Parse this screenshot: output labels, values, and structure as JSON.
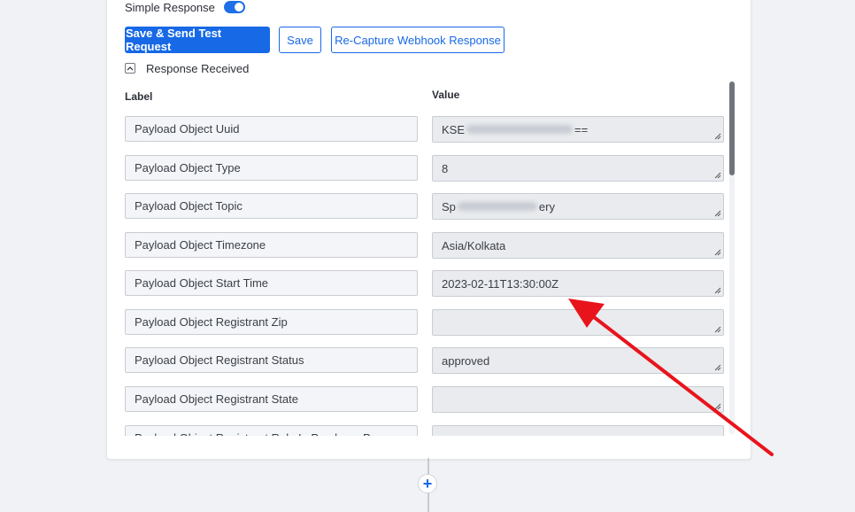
{
  "simple_response": {
    "label": "Simple Response",
    "enabled": true
  },
  "buttons": {
    "save_send": "Save & Send Test Request",
    "save": "Save",
    "recapture": "Re-Capture Webhook Response"
  },
  "response_received": {
    "label": "Response Received",
    "expanded": true
  },
  "table": {
    "label_header": "Label",
    "value_header": "Value",
    "rows": [
      {
        "label": "Payload Object Uuid",
        "value_prefix": "KSE",
        "value_suffix": "==",
        "blurred": true
      },
      {
        "label": "Payload Object Type",
        "value": "8"
      },
      {
        "label": "Payload Object Topic",
        "value_prefix": "Sp",
        "value_suffix": "ery",
        "blurred": true
      },
      {
        "label": "Payload Object Timezone",
        "value": "Asia/Kolkata"
      },
      {
        "label": "Payload Object Start Time",
        "value": "2023-02-11T13:30:00Z"
      },
      {
        "label": "Payload Object Registrant Zip",
        "value": ""
      },
      {
        "label": "Payload Object Registrant Status",
        "value": "approved"
      },
      {
        "label": "Payload Object Registrant State",
        "value": ""
      },
      {
        "label": "Payload Object Registrant Role In Purchase Process",
        "value": ""
      }
    ]
  },
  "colors": {
    "primary": "#1769e6",
    "annotation_arrow": "#e8141c"
  },
  "icons": {
    "collapse": "chevron-up-icon",
    "add": "plus-icon",
    "resize": "resize-grip-icon"
  }
}
